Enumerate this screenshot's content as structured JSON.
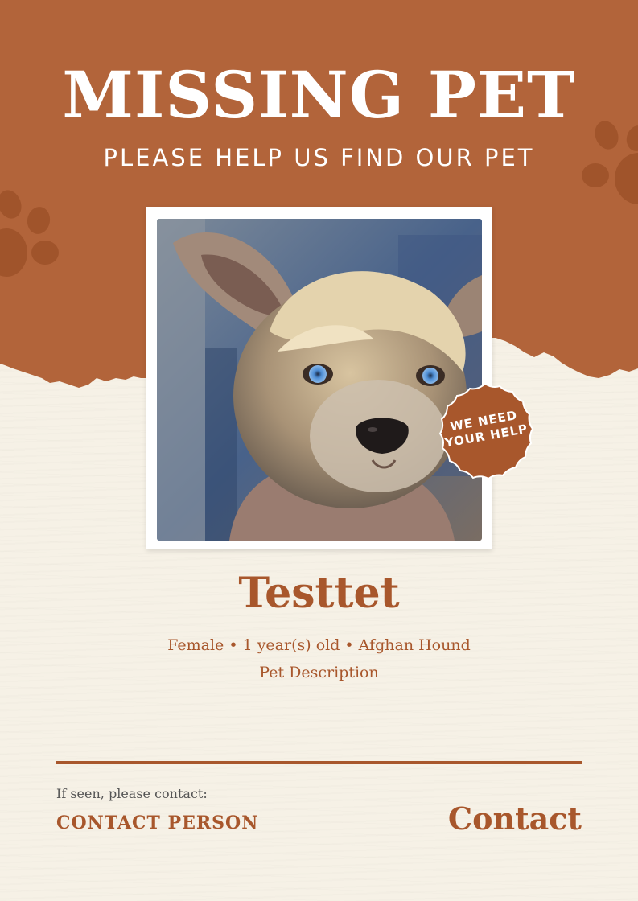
{
  "colors": {
    "brand": "#b2643a",
    "brand_dark": "#a8572c",
    "paper": "#f6f1e6",
    "text_muted": "#555555",
    "white": "#ffffff"
  },
  "header": {
    "title": "MISSING PET",
    "subtitle": "PLEASE HELP US FIND OUR PET"
  },
  "photo": {
    "subject": "dog-photo"
  },
  "badge": {
    "line1": "WE NEED",
    "line2": "YOUR HELP"
  },
  "pet": {
    "name": "Testtet",
    "details": "Female • 1 year(s) old • Afghan Hound",
    "description": "Pet Description"
  },
  "contact": {
    "prompt": "If seen, please contact:",
    "person": "CONTACT PERSON",
    "value": "Contact"
  }
}
